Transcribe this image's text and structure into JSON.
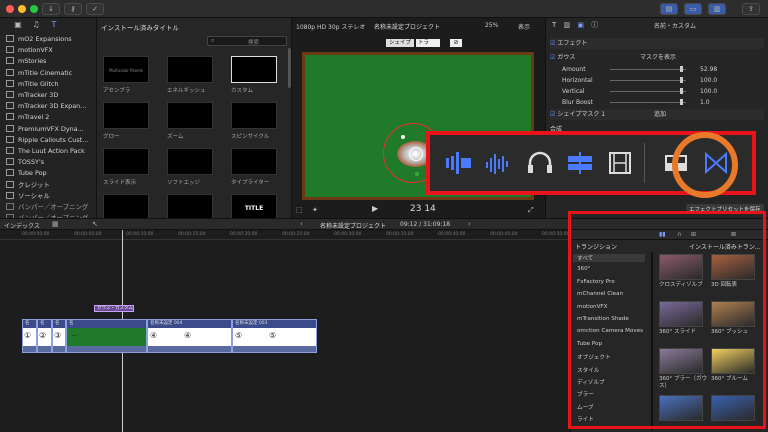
{
  "library": {
    "items": [
      "mO2 Expansions",
      "motionVFX",
      "mStories",
      "mTitle Cinematic",
      "mTitle Glitch",
      "mTracker 3D",
      "mTracker 3D Expan...",
      "mTravel 2",
      "PremiumVFX Dyna...",
      "Ripple Callouts Cust...",
      "The Luut Action Pack",
      "TOSSY's",
      "Tube Pop",
      "クレジット",
      "ソーシャル",
      "バンパー／オープニング",
      "バンパー／オープニング"
    ]
  },
  "browser": {
    "title": "インストール済みタイトル",
    "search_placeholder": "検索",
    "thumbs": [
      {
        "label": "アセンブラ",
        "inner": "Multicolor Panels"
      },
      {
        "label": "エネルギッシュ",
        "inner": ""
      },
      {
        "label": "カスタム",
        "inner": ""
      },
      {
        "label": "グロー",
        "inner": ""
      },
      {
        "label": "ズーム",
        "inner": ""
      },
      {
        "label": "スピンサイクル",
        "inner": ""
      },
      {
        "label": "スライド表示",
        "inner": ""
      },
      {
        "label": "ソフトエッジ",
        "inner": ""
      },
      {
        "label": "タイプライター",
        "inner": ""
      },
      {
        "label": "",
        "inner": ""
      },
      {
        "label": "",
        "inner": ""
      },
      {
        "label": "",
        "inner": "TITLE"
      }
    ]
  },
  "viewer": {
    "format": "1080p HD 30p ステレオ",
    "project": "名称未設定プロジェクト",
    "zoom": "25%",
    "view": "表示",
    "shape_label": "シェイプ",
    "shape_value": "トラッ...",
    "timecode": "23 14"
  },
  "inspector": {
    "title": "名前・カスタム",
    "effects_label": "エフェクト",
    "blur_label": "ガウス",
    "mask_label": "マスクを表示",
    "params": [
      {
        "name": "Amount",
        "value": "52.98"
      },
      {
        "name": "Horizontal",
        "value": "100.0"
      },
      {
        "name": "Vertical",
        "value": "100.0"
      },
      {
        "name": "Blur Boost",
        "value": "1.0"
      }
    ],
    "shape_mask": "シェイプマスク 1",
    "shape_mask_mode": "追加",
    "extra_label": "合成",
    "save_preset": "エフェクトプリセットを保存"
  },
  "timeline": {
    "index_label": "インデックス",
    "project": "名称未設定プロジェクト",
    "duration": "09:12 / 31:09:18",
    "ruler": [
      "00:00:00:00",
      "00:00:05:00",
      "00:00:10:00",
      "00:00:15:00",
      "00:00:20:00",
      "00:00:25:00",
      "00:00:30:00",
      "00:00:35:00",
      "00:00:40:00",
      "00:00:45:00",
      "00:00:50:00"
    ],
    "title_clip": "ガウス・カスタム",
    "clips": [
      {
        "name": "名",
        "num": "①"
      },
      {
        "name": "名",
        "num": "②"
      },
      {
        "name": "名",
        "num": "③"
      },
      {
        "name": "名",
        "num": "--"
      },
      {
        "name": "名称未設定 004",
        "num": "④"
      },
      {
        "name": "名称未設定 003",
        "num": "⑤"
      }
    ]
  },
  "transitions": {
    "header": "トランジション",
    "installed": "インストール済みトラン...",
    "categories": [
      "すべて",
      "360°",
      "FxFactory Pro",
      "mChannel Clean",
      "motionVFX",
      "mTransition Shade",
      "omction Camera Moves",
      "Tube Pop",
      "オブジェクト",
      "スタイル",
      "ディゾルブ",
      "ブラー",
      "ムーブ",
      "ライト"
    ],
    "thumbs": [
      {
        "label": "クロスディゾルブ",
        "color": "#8a5a6a"
      },
      {
        "label": "3D 回転表",
        "color": "#a86040"
      },
      {
        "label": "360° スライド",
        "color": "#7a6a9a"
      },
      {
        "label": "360° ブッシュ",
        "color": "#b08050"
      },
      {
        "label": "360° ブラー（ガウス）",
        "color": "#8a7a9a"
      },
      {
        "label": "360° ブルーム",
        "color": "#f0d060"
      },
      {
        "label": "",
        "color": "#4a70c0"
      },
      {
        "label": "",
        "color": "#3a60b0"
      }
    ]
  },
  "colors": {
    "accent": "#3a7bff",
    "highlight": "#e8141a",
    "circle": "#e8792a",
    "viewer_green": "#1f7a2a"
  }
}
